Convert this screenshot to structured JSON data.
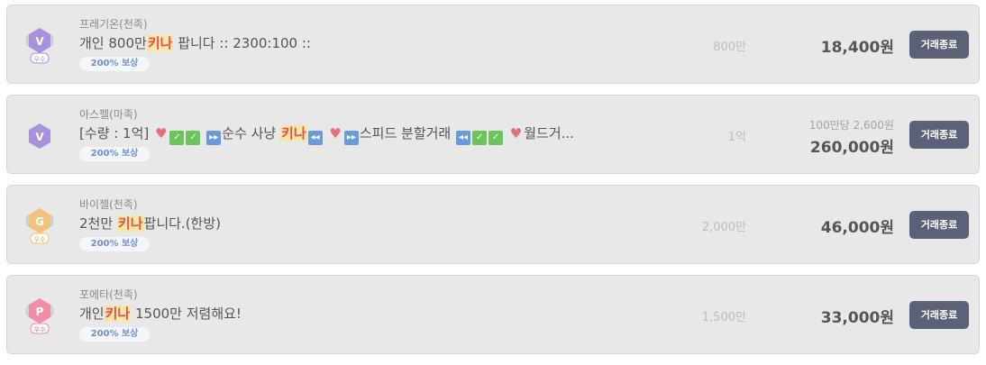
{
  "listings": [
    {
      "server": "프레기온(천족)",
      "title_pre": "개인 800만",
      "title_highlight": "키나",
      "title_post": " 팝니다 :: 2300:100 ::",
      "compensation": "200% 보상",
      "quantity": "800만",
      "unit_price": "",
      "price": "18,400원",
      "button": "거래종료",
      "grade_letter": "V",
      "grade_label": "우수",
      "grade_color": "#a892dc"
    },
    {
      "server": "아스펠(마족)",
      "title_parts": {
        "p1": "[수량 : 1억]",
        "p2": "순수 사냥",
        "highlight": "키나",
        "p3": "스피드 분할거래",
        "p4": "월드거..."
      },
      "compensation": "200% 보상",
      "quantity": "1억",
      "unit_price": "100만당 2,600원",
      "price": "260,000원",
      "button": "거래종료",
      "grade_letter": "V",
      "grade_label": "",
      "grade_color": "#a892dc"
    },
    {
      "server": "바이젤(천족)",
      "title_pre": "2천만 ",
      "title_highlight": "키나",
      "title_post": "팝니다.(한방)",
      "compensation": "200% 보상",
      "quantity": "2,000만",
      "unit_price": "",
      "price": "46,000원",
      "button": "거래종료",
      "grade_letter": "G",
      "grade_label": "우수",
      "grade_color": "#efc27d"
    },
    {
      "server": "포에타(천족)",
      "title_pre": "개인",
      "title_highlight": "키나",
      "title_post": " 1500만 저렴해요!",
      "compensation": "200% 보상",
      "quantity": "1,500만",
      "unit_price": "",
      "price": "33,000원",
      "button": "거래종료",
      "grade_letter": "P",
      "grade_label": "우수",
      "grade_color": "#ee8ea7"
    }
  ],
  "colors": {
    "card_bg": "#e8e8e8",
    "button_bg": "#5b6277",
    "highlight_bg": "#f6e6a8",
    "highlight_text": "#e0524a"
  }
}
